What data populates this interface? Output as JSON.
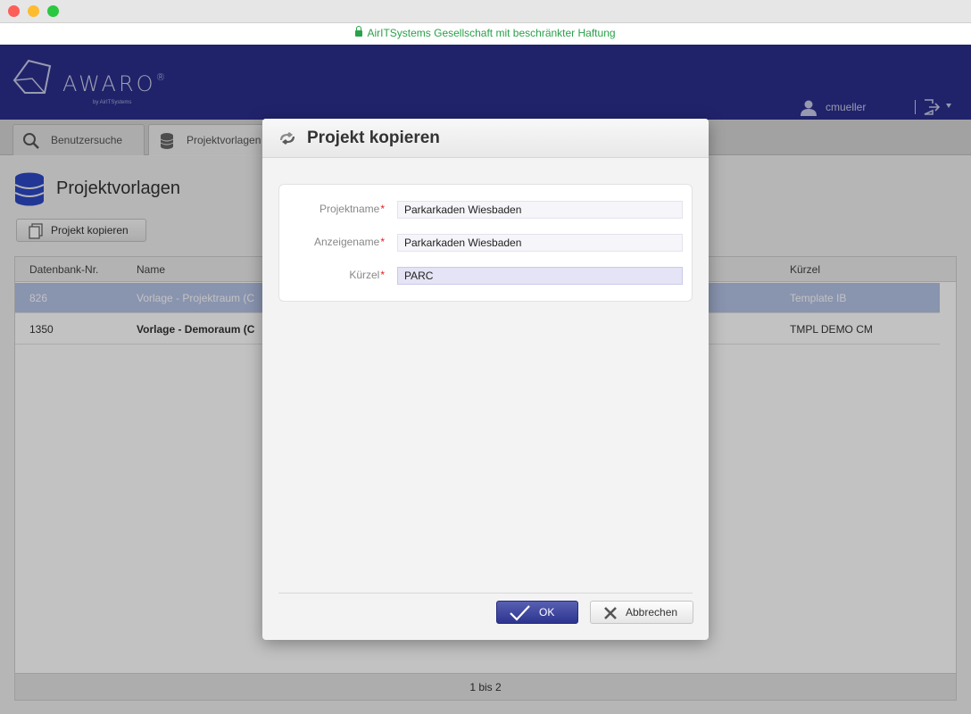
{
  "browser": {
    "url_text": "AirITSystems Gesellschaft mit beschränkter Haftung",
    "url_color": "#2aa14a"
  },
  "header": {
    "brand": "AWARO",
    "brand_mark": "®",
    "brand_sub": "by AirITSystems",
    "user_name": "cmueller",
    "background": "#2b2f8c",
    "icons": [
      "user-icon",
      "logout-icon"
    ]
  },
  "tabs": [
    {
      "label": "Benutzersuche",
      "icon": "search-icon"
    },
    {
      "label": "Projektvorlagen",
      "icon": "database-icon"
    }
  ],
  "page": {
    "title": "Projektvorlagen",
    "copy_button": "Projekt kopieren"
  },
  "table": {
    "columns": [
      "Datenbank-Nr.",
      "Name",
      "Kürzel"
    ],
    "rows": [
      {
        "id": "826",
        "name": "Vorlage - Projektraum (C",
        "short": "Template IB",
        "selected": true
      },
      {
        "id": "1350",
        "name": "Vorlage - Demoraum (C",
        "short": "TMPL DEMO CM",
        "selected": false
      }
    ],
    "footer": "1 bis 2"
  },
  "dialog": {
    "title": "Projekt kopieren",
    "fields": [
      {
        "label": "Projektname",
        "required_mark": "*",
        "value": "Parkarkaden Wiesbaden"
      },
      {
        "label": "Anzeigename",
        "required_mark": "*",
        "value": "Parkarkaden Wiesbaden"
      },
      {
        "label": "Kürzel",
        "required_mark": "*",
        "value": "PARC",
        "focused": true
      }
    ],
    "ok_label": "OK",
    "cancel_label": "Abbrechen",
    "accent": "#2d348f"
  }
}
